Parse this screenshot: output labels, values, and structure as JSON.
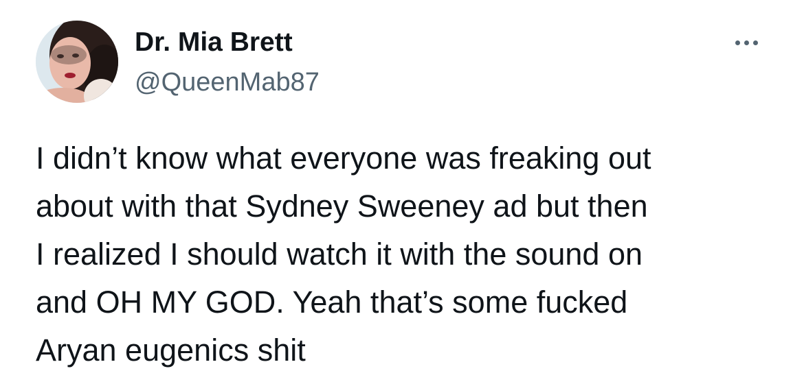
{
  "tweet": {
    "author": {
      "display_name": "Dr. Mia Brett",
      "handle": "@QueenMab87",
      "avatar_icon": "profile-photo"
    },
    "more_icon": "more-options-icon",
    "text_lines": [
      "I didn’t know what everyone was freaking out",
      "about with that Sydney Sweeney ad but then",
      "I realized I should watch it with the sound on",
      "and OH MY GOD. Yeah that’s some fucked",
      "Aryan eugenics shit"
    ],
    "colors": {
      "text": "#0f1419",
      "secondary": "#536471",
      "background": "#ffffff"
    }
  }
}
